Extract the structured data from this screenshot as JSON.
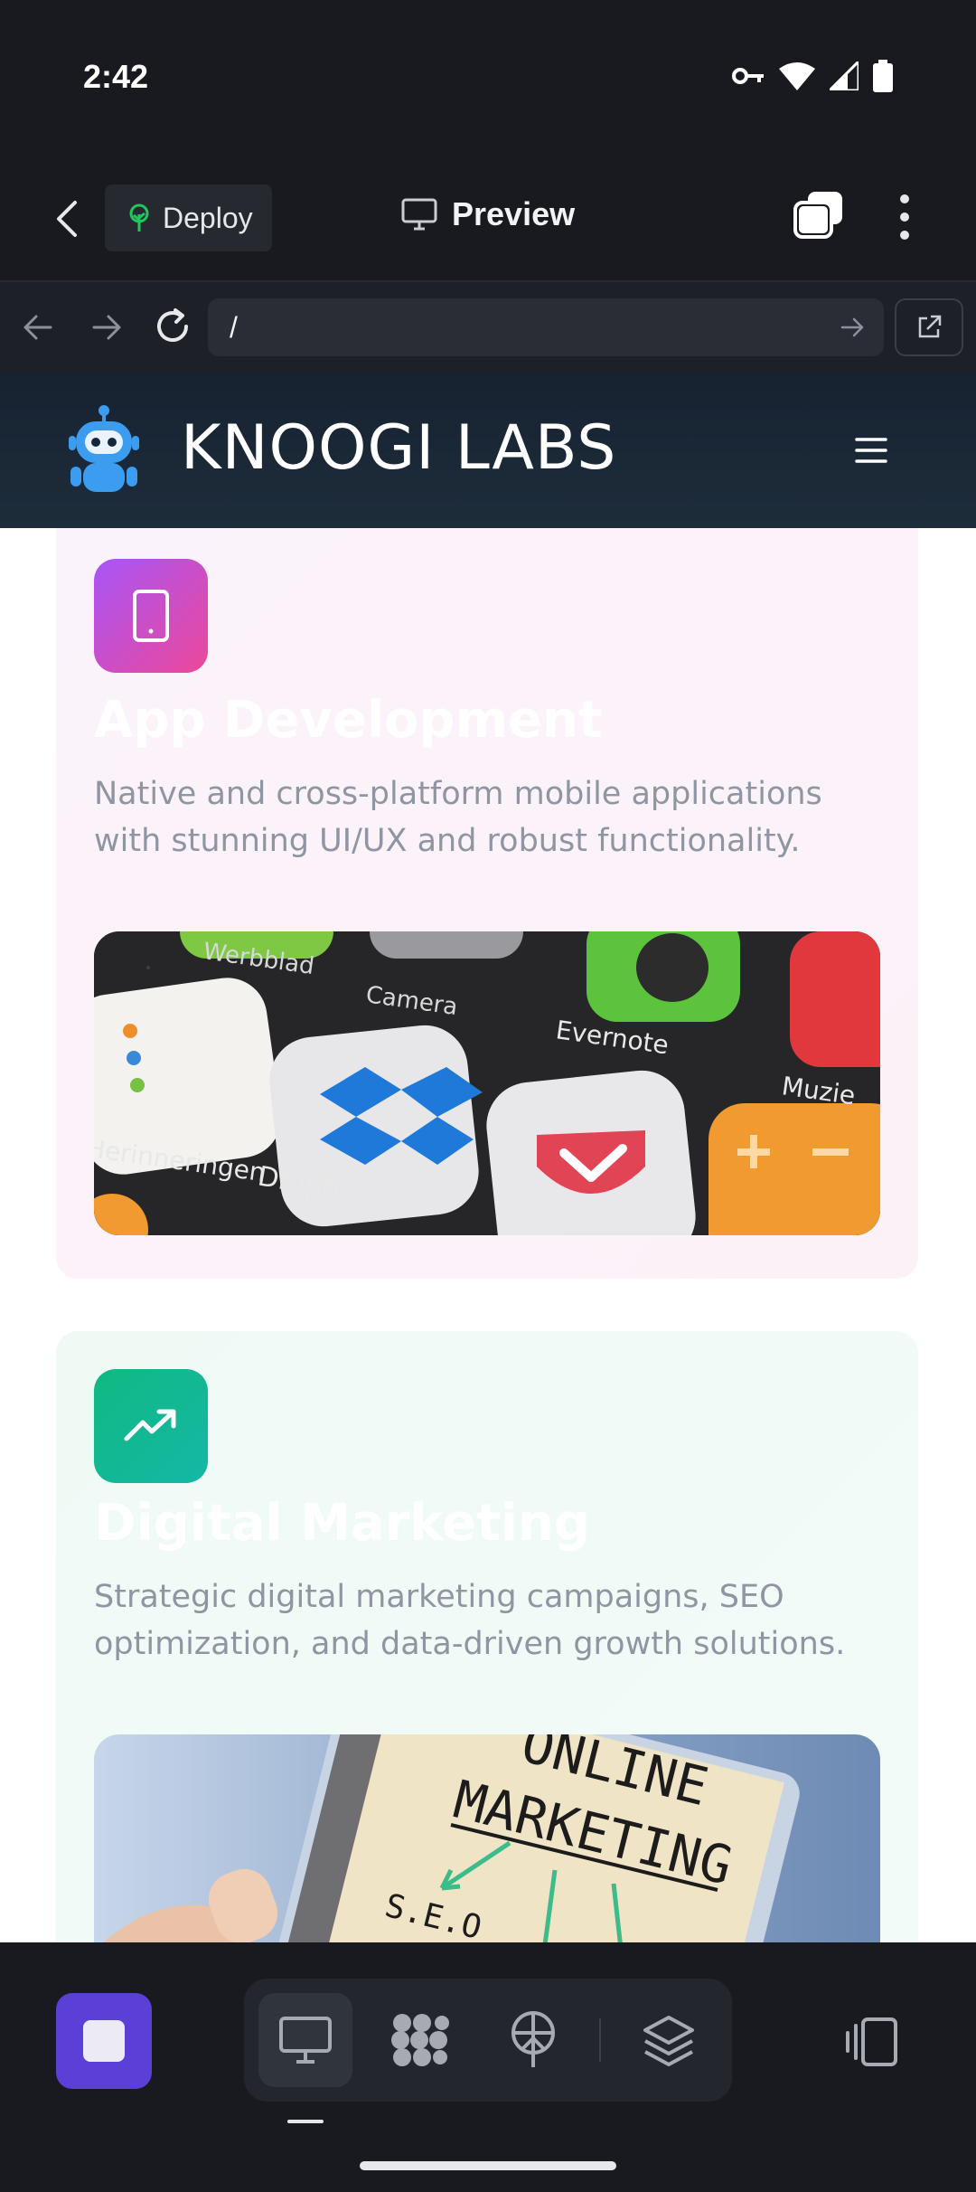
{
  "status": {
    "time": "2:42"
  },
  "toolbar": {
    "deploy_label": "Deploy",
    "preview_label": "Preview"
  },
  "urlbar": {
    "url": "/"
  },
  "site": {
    "title": "KNOOGI LABS"
  },
  "cards": [
    {
      "title": "App Development",
      "description": "Native and cross-platform mobile applications with stunning UI/UX and robust functionality.",
      "icon": "tablet-icon",
      "icon_colors": [
        "#a855f7",
        "#ec4899"
      ],
      "image_labels": [
        "Werbblad",
        "Camera",
        "Evernote",
        "Muzie",
        "Herinneringen",
        "Dropbox"
      ]
    },
    {
      "title": "Digital Marketing",
      "description": "Strategic digital marketing campaigns, SEO optimization, and data-driven growth solutions.",
      "icon": "trending-up-icon",
      "icon_colors": [
        "#10b981",
        "#14b8a6"
      ],
      "image_labels": [
        "ONLINE",
        "MARKETING",
        "S.E.O"
      ]
    }
  ],
  "colors": {
    "accent": "#5b3fd6",
    "background": "#181a20"
  }
}
